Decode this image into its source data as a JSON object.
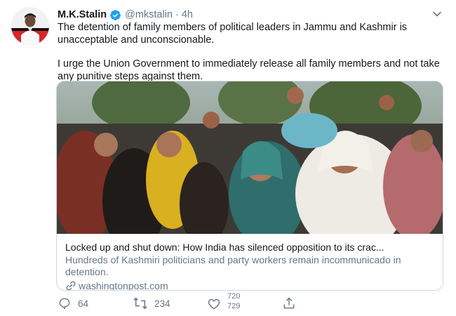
{
  "tweet": {
    "author_name": "M.K.Stalin",
    "handle": "@mkstalin",
    "separator": "·",
    "time": "4h",
    "paragraphs": [
      "The detention of family members of political leaders in Jammu and Kashmir is unacceptable and unconscionable.",
      "I urge the Union Government to immediately release all family members and not take any punitive steps against them."
    ]
  },
  "card": {
    "title": "Locked up and shut down: How India has silenced opposition to its crac...",
    "description": "Hundreds of Kashmiri politicians and party workers remain incommunicado in detention.",
    "domain": "washingtonpost.com"
  },
  "actions": {
    "replies": "64",
    "retweets": "234",
    "likes_old": "720",
    "likes_new": "729"
  },
  "icons": {
    "verified": "verified-badge-icon",
    "menu": "chevron-down-icon",
    "reply": "reply-icon",
    "retweet": "retweet-icon",
    "like": "heart-icon",
    "share": "share-icon",
    "link": "link-icon"
  },
  "colors": {
    "verified_blue": "#1da1f2",
    "muted_text": "#657786",
    "card_border": "#ccd6dd",
    "avatar_red": "#d7262a"
  }
}
